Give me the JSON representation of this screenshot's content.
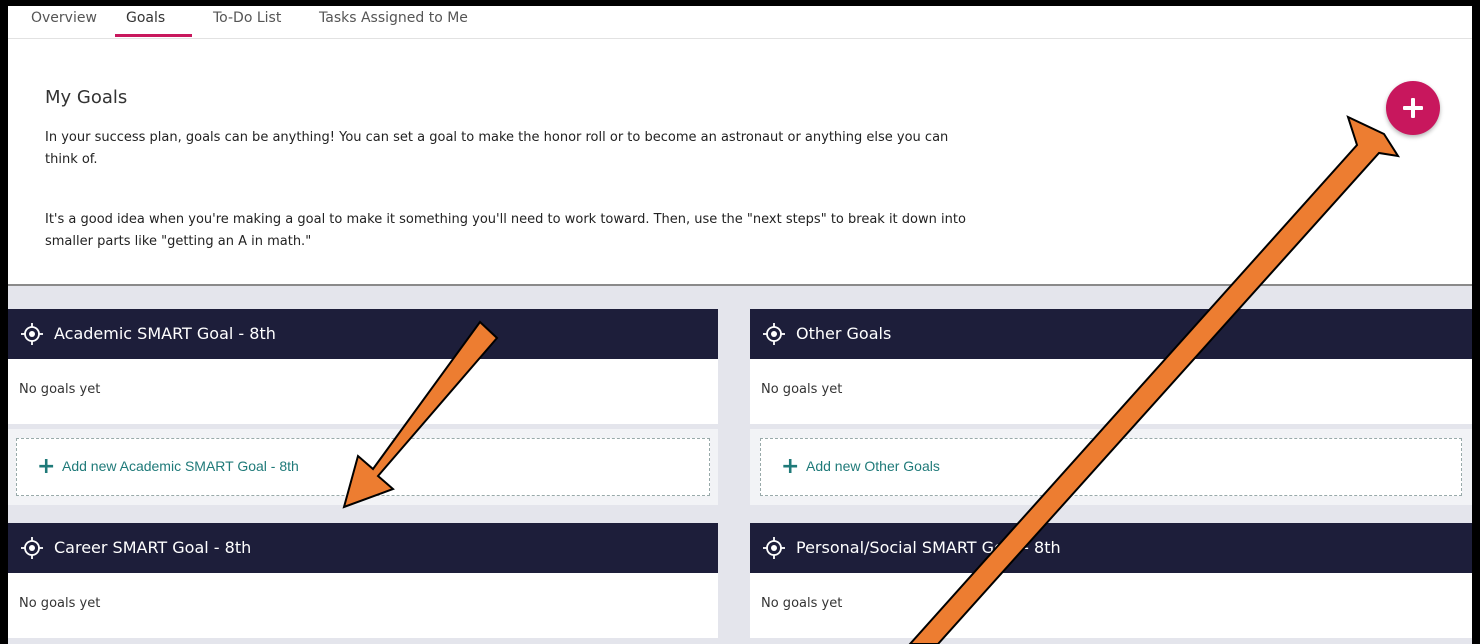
{
  "tabs": {
    "items": [
      {
        "label": "Overview"
      },
      {
        "label": "Goals"
      },
      {
        "label": "To-Do List"
      },
      {
        "label": "Tasks Assigned to Me"
      }
    ],
    "active": "Goals"
  },
  "intro": {
    "title": "My Goals",
    "paragraph1": "In your success plan, goals can be anything! You can set a goal to make the honor roll or to become an astronaut or anything else you can think of.",
    "paragraph2": "It's a good idea when you're making a goal to make it something you'll need to work toward. Then, use the \"next steps\" to break it down into smaller parts like \"getting an A in math.\"",
    "add_button_icon": "plus-icon"
  },
  "cards": [
    {
      "title": "Academic SMART Goal - 8th",
      "empty": "No goals yet",
      "add_label": "Add new Academic SMART Goal - 8th"
    },
    {
      "title": "Other Goals",
      "empty": "No goals yet",
      "add_label": "Add new Other Goals"
    },
    {
      "title": "Career SMART Goal - 8th",
      "empty": "No goals yet"
    },
    {
      "title": "Personal/Social SMART Goal - 8th",
      "empty": "No goals yet"
    }
  ],
  "colors": {
    "accent": "#c8175d",
    "header": "#1d1e3a",
    "link": "#1f7a79",
    "annotation_arrow": "#ed7d31"
  }
}
